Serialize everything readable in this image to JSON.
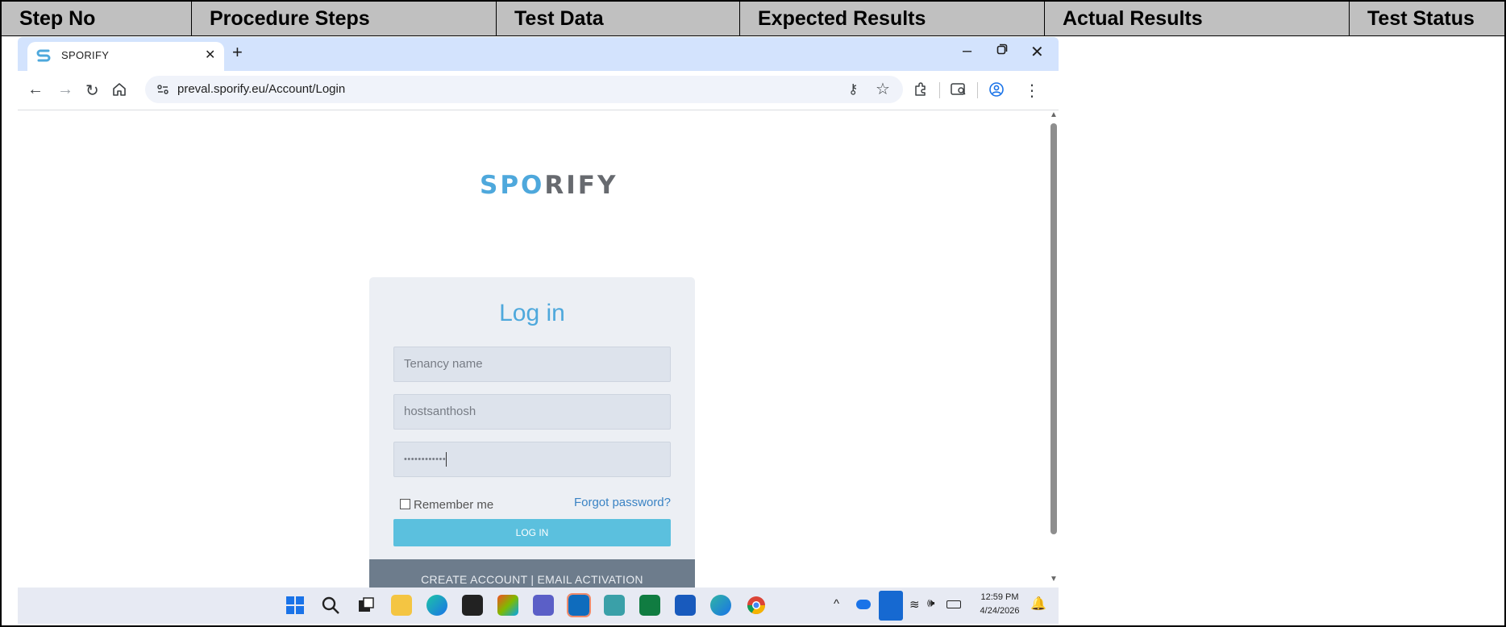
{
  "table": {
    "headers": [
      "Step No",
      "Procedure Steps",
      "Test Data",
      "Expected Results",
      "Actual Results",
      "Test Status"
    ]
  },
  "browser": {
    "tab_title": "SPORIFY",
    "url": "preval.sporify.eu/Account/Login"
  },
  "page": {
    "logo_text_start": "SP",
    "logo_text_o": "O",
    "logo_text_end": "RIFY",
    "login_title": "Log in",
    "tenancy_placeholder": "Tenancy name",
    "username_value": "hostsanthosh",
    "password_value": "••••••••••••",
    "remember_label": "Remember me",
    "forgot_label": "Forgot password?",
    "login_button": "LOG IN",
    "footer_links": "CREATE ACCOUNT | EMAIL ACTIVATION"
  },
  "taskbar": {
    "time": "12:59 PM",
    "date": "4/24/2026"
  },
  "colors": {
    "accent": "#4ea8dc",
    "login_button": "#5bc0de",
    "card_footer": "#6d7c8c",
    "table_header": "#c0c0c0"
  }
}
